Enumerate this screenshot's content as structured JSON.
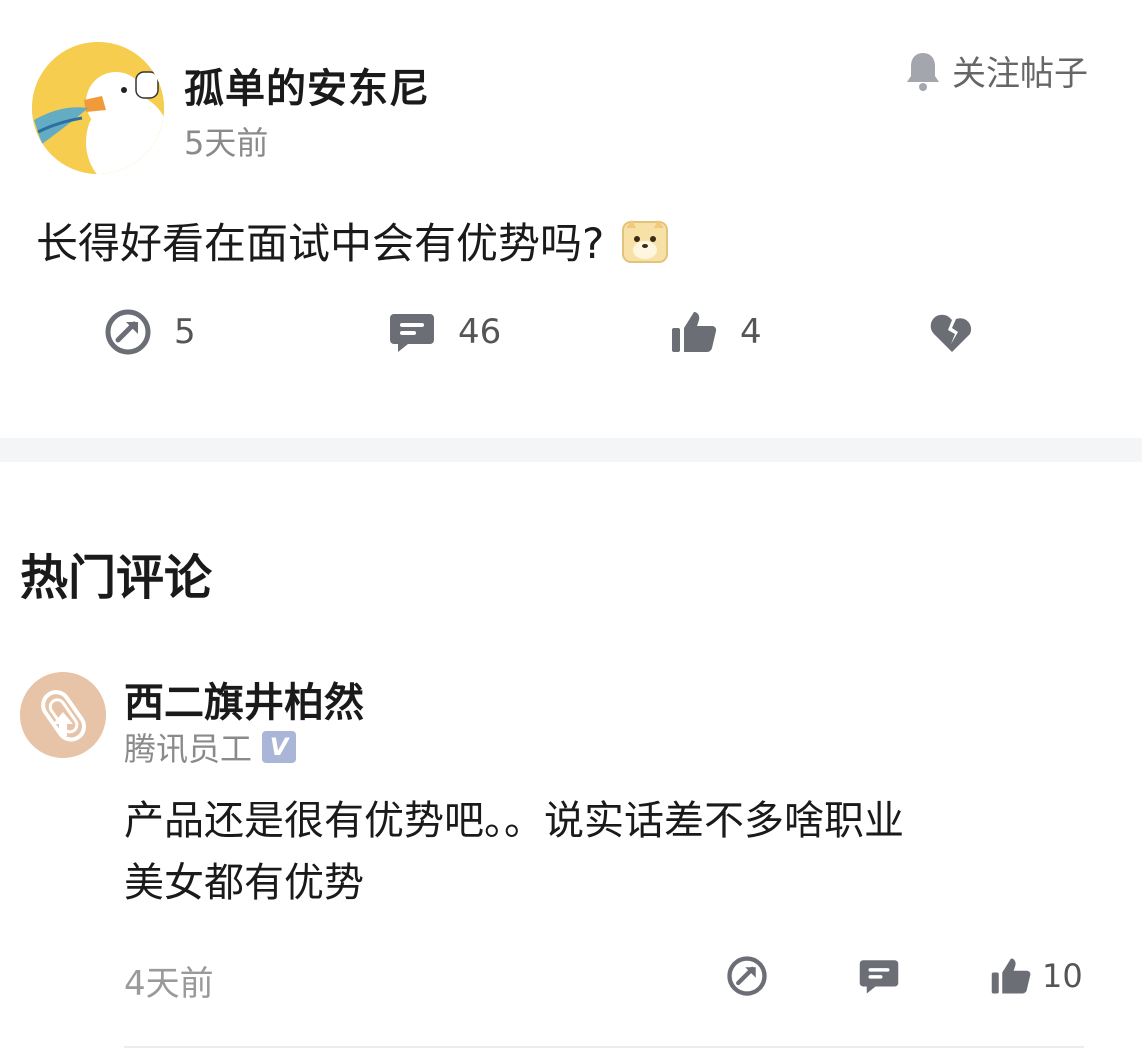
{
  "post": {
    "author": "孤单的安东尼",
    "time": "5天前",
    "follow_label": "关注帖子",
    "title": "长得好看在面试中会有优势吗?",
    "title_emoji": "doge-emoji",
    "actions": {
      "share_count": "5",
      "comment_count": "46",
      "like_count": "4"
    }
  },
  "hot_comments": {
    "section_title": "热门评论",
    "items": [
      {
        "author": "西二旗井柏然",
        "company": "腾讯员工",
        "verified_mark": "V",
        "body_line1": "产品还是很有优势吧。。说实话差不多啥职业",
        "body_line2": "美女都有优势",
        "time": "4天前",
        "like_count": "10"
      }
    ]
  },
  "icons": {
    "follow": "bell-icon",
    "share": "share-icon",
    "comment": "comment-icon",
    "like": "thumbs-up-icon",
    "dislike": "broken-heart-icon"
  },
  "colors": {
    "icon_gray": "#6b6e75",
    "avatar_yellow": "#f6cd4f",
    "verified_blue": "#a9b6d8",
    "band_gray": "#f4f5f7"
  }
}
